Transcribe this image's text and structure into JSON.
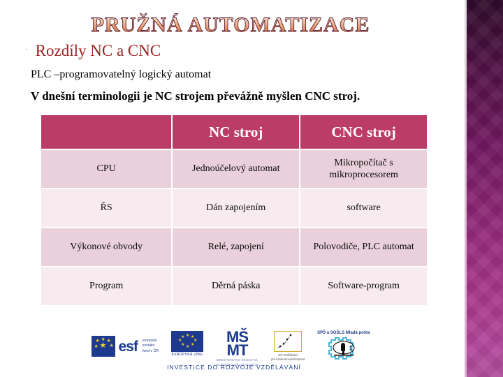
{
  "slide": {
    "title": "PRUŽNÁ AUTOMATIZACE",
    "bullet": {
      "marker": "·",
      "text": "Rozdíly NC a CNC"
    },
    "paragraphs": {
      "plc": "PLC –programovatelný logický automat",
      "emphasis": "V dnešní terminologii je NC strojem převážně myšlen CNC stroj."
    }
  },
  "table": {
    "headers": [
      "",
      "NC stroj",
      "CNC stroj"
    ],
    "rows": [
      [
        "CPU",
        "Jednoúčelový automat",
        "Mikropočítač s mikroprocesorem"
      ],
      [
        "ŘS",
        "Dán zapojením",
        "software"
      ],
      [
        "Výkonové obvody",
        "Relé, zapojení",
        "Polovodiče, PLC automat"
      ],
      [
        "Program",
        "Děrná páska",
        "Software-program"
      ]
    ]
  },
  "footer": {
    "logos": {
      "esf": {
        "word": "esf",
        "sub_line1": "evropský",
        "sub_line2": "sociální",
        "sub_line3": "fond v ČR"
      },
      "eu": {
        "caption": "EVROPSKÁ UNIE"
      },
      "msmt": {
        "mark_line1": "MŠ",
        "mark_line2": "MT",
        "caption_line1": "MINISTERSTVO ŠKOLSTVÍ,",
        "caption_line2": "MLÁDEŽE A TĚLOVÝCHOVY"
      },
      "opvk": {
        "caption_line1": "OP Vzdělávání",
        "caption_line2": "pro konkurenceschopnost"
      },
      "school": {
        "caption": "SPŠ a SOŠLS Mladá pošta"
      }
    },
    "tagline": "INVESTICE DO ROZVOJE VZDĚLÁVÁNÍ"
  },
  "colors": {
    "header_bg": "#bc3c68",
    "row_shade": "#ead0db",
    "row_light": "#f7ebef",
    "bullet_text": "#9e2222",
    "band_top": "#2e0c2a",
    "band_bottom": "#b04f9c",
    "logo_blue": "#1d3a8f"
  }
}
